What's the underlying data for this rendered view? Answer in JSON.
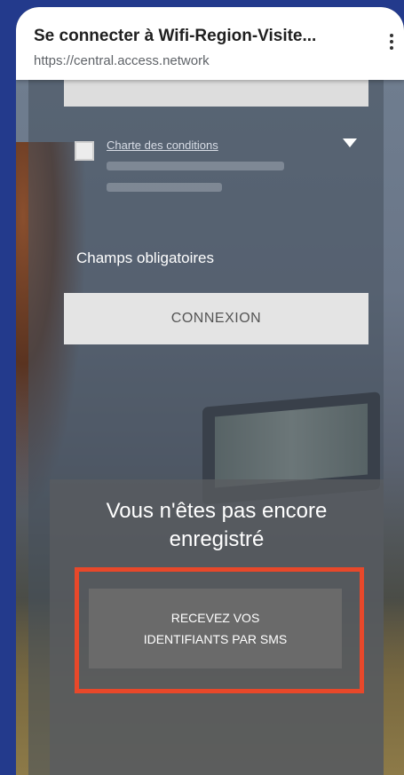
{
  "browser": {
    "title": "Se connecter à Wifi-Region-Visite...",
    "url": "https://central.access.network",
    "menu_icon": "more-vert-icon"
  },
  "form": {
    "conditions_link": "Charte des conditions",
    "required_label": "Champs obligatoires",
    "login_button": "CONNEXION"
  },
  "register": {
    "title_line1": "Vous n'êtes pas encore",
    "title_line2": "enregistré",
    "sms_button_line1": "RECEVEZ VOS",
    "sms_button_line2": "IDENTIFIANTS PAR SMS"
  },
  "colors": {
    "page_background": "#233a8c",
    "highlight_border": "#e8482a"
  }
}
